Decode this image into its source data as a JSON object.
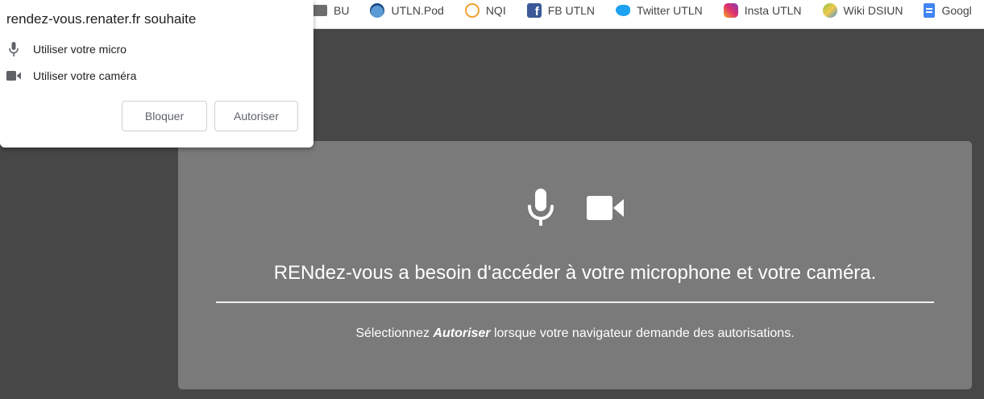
{
  "bookmarks": [
    {
      "label": "BU",
      "icon": "folder-icon"
    },
    {
      "label": "UTLN.Pod",
      "icon": "pod-icon"
    },
    {
      "label": "NQI",
      "icon": "nqi-icon"
    },
    {
      "label": "FB UTLN",
      "icon": "facebook-icon"
    },
    {
      "label": "Twitter UTLN",
      "icon": "twitter-icon"
    },
    {
      "label": "Insta UTLN",
      "icon": "instagram-icon"
    },
    {
      "label": "Wiki DSIUN",
      "icon": "wiki-icon"
    },
    {
      "label": "Googl",
      "icon": "google-docs-icon"
    }
  ],
  "popup": {
    "title": "rendez-vous.renater.fr souhaite",
    "permissions": [
      {
        "label": "Utiliser votre micro",
        "icon": "microphone-icon"
      },
      {
        "label": "Utiliser votre caméra",
        "icon": "camera-icon"
      }
    ],
    "block_label": "Bloquer",
    "allow_label": "Autoriser"
  },
  "card": {
    "title": "RENdez-vous a besoin d'accéder à votre microphone et votre caméra.",
    "hint_before": "Sélectionnez ",
    "hint_bold": "Autoriser",
    "hint_after": " lorsque votre navigateur demande des autorisations."
  },
  "colors": {
    "page_background": "#474747",
    "card_background": "#7a7a7a",
    "text_on_card": "#ffffff"
  }
}
